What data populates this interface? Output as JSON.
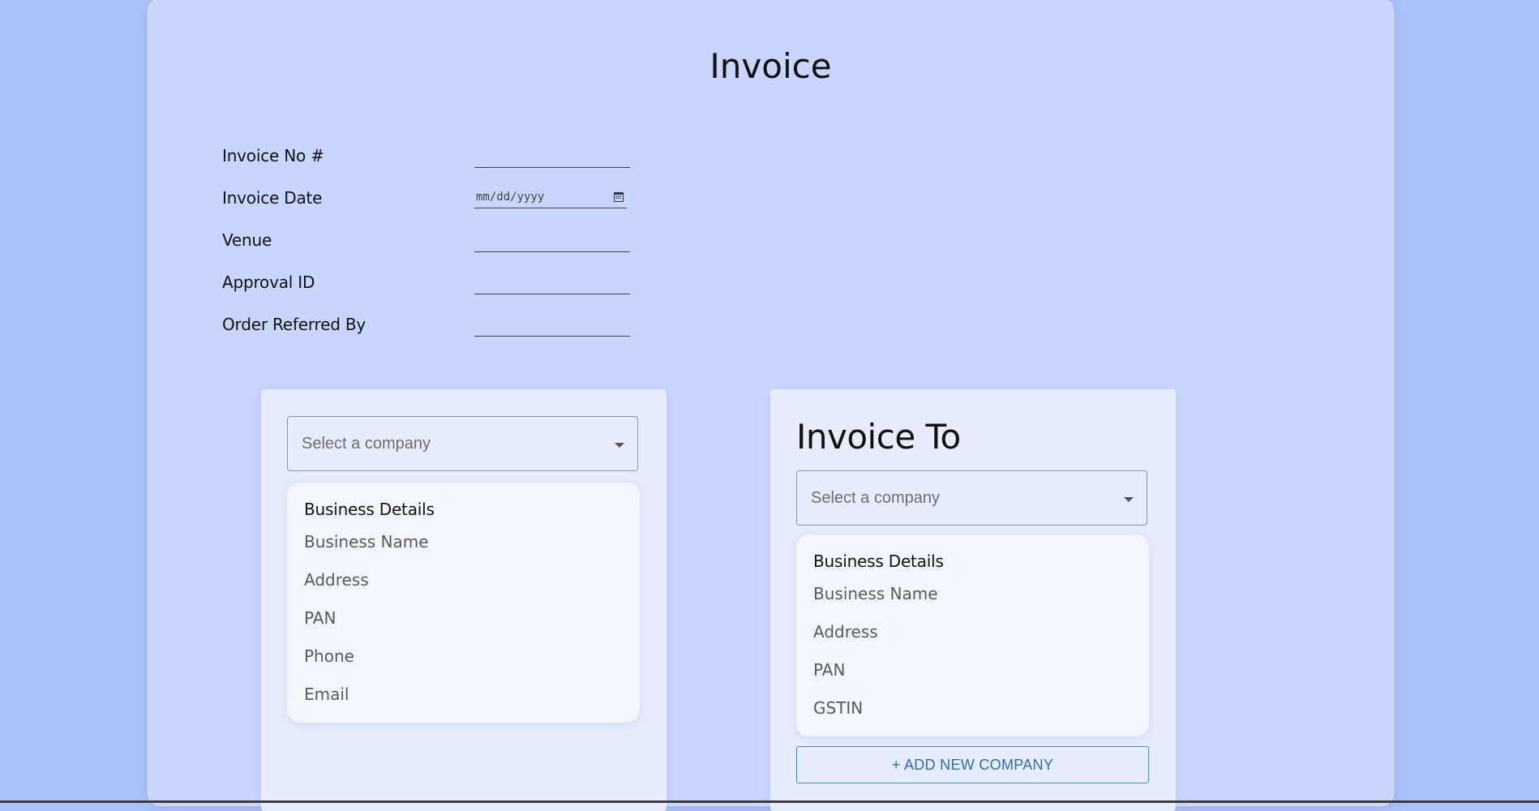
{
  "title": "Invoice",
  "meta_fields": [
    {
      "label": "Invoice No #",
      "value": ""
    },
    {
      "label": "Invoice Date",
      "placeholder": "mm/dd/yyyy"
    },
    {
      "label": "Venue",
      "value": ""
    },
    {
      "label": "Approval ID",
      "value": ""
    },
    {
      "label": "Order Referred By",
      "value": ""
    }
  ],
  "from_card": {
    "select_placeholder": "Select a company",
    "details_heading": "Business Details",
    "fields": [
      "Business Name",
      "Address",
      "PAN",
      "Phone",
      "Email"
    ]
  },
  "to_card": {
    "title": "Invoice To",
    "select_placeholder": "Select a company",
    "details_heading": "Business Details",
    "fields": [
      "Business Name",
      "Address",
      "PAN",
      "GSTIN"
    ],
    "add_button": "+ ADD NEW COMPANY"
  },
  "icons": {
    "date_picker": "calendar-icon",
    "dropdown": "chevron-down-icon"
  }
}
